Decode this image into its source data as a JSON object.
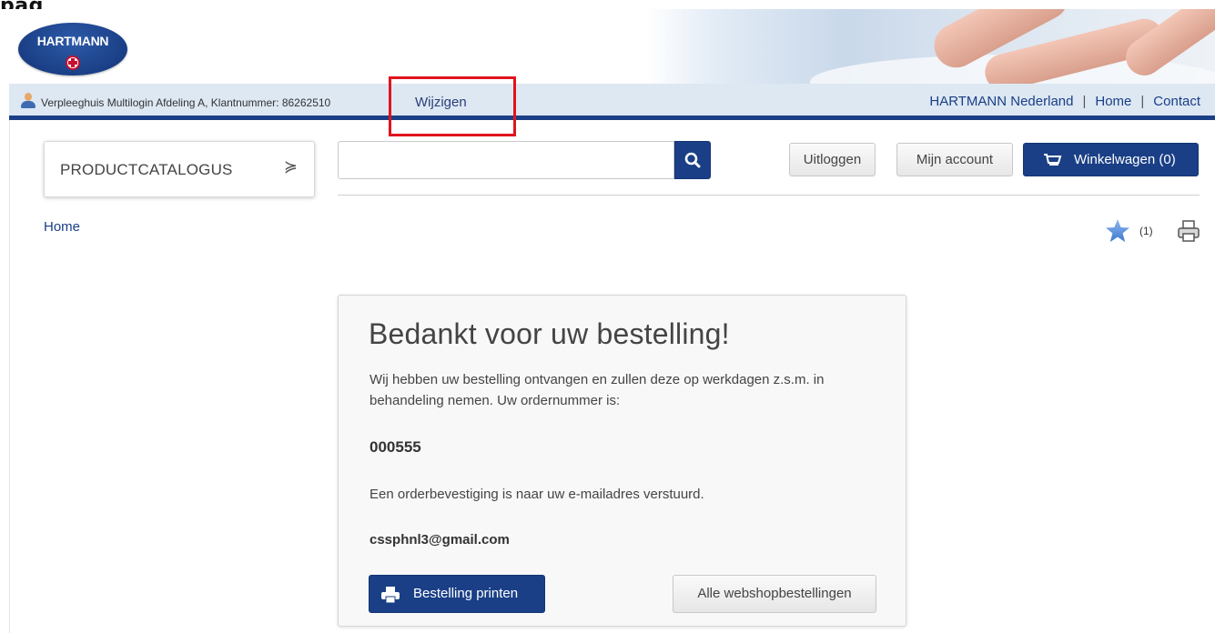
{
  "page_corner_text": "pag",
  "brand": {
    "logo_text": "HARTMANN"
  },
  "topbar": {
    "account_text": "Verpleeghuis Multilogin Afdeling A, Klantnummer: 86262510",
    "change_link": "Wijzigen",
    "links": [
      "HARTMANN Nederland",
      "Home",
      "Contact"
    ],
    "separator": "|"
  },
  "catalog": {
    "label": "PRODUCTCATALOGUS",
    "toggle_glyph": "≽"
  },
  "search": {
    "value": "",
    "placeholder": ""
  },
  "header_buttons": {
    "logout": "Uitloggen",
    "account": "Mijn account",
    "cart": "Winkelwagen (0)"
  },
  "breadcrumb": {
    "home": "Home"
  },
  "favorites": {
    "count": "(1)"
  },
  "confirmation": {
    "title": "Bedankt voor uw bestelling!",
    "message": "Wij hebben uw bestelling ontvangen en zullen deze op werkdagen z.s.m. in behandeling nemen. Uw ordernummer is:",
    "order_number": "000555",
    "mail_message": "Een orderbevestiging is naar uw e-mailadres verstuurd.",
    "email": "cssphnl3@gmail.com",
    "print_button": "Bestelling printen",
    "all_orders_button": "Alle webshopbestellingen"
  },
  "colors": {
    "brand_blue": "#1a3f86",
    "topbar_bg": "#dde8f3",
    "highlight": "#e0141e"
  }
}
